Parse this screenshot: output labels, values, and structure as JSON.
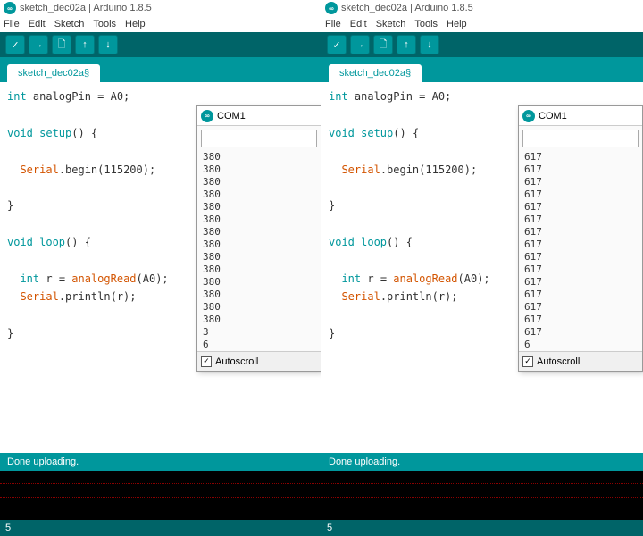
{
  "app": {
    "title_left": "sketch_dec02a | Arduino 1.8.5",
    "title_right": "sketch_dec02a | Arduino 1.8.5",
    "logo_text": "∞"
  },
  "menu": {
    "items": [
      "File",
      "Edit",
      "Sketch",
      "Tools",
      "Help"
    ]
  },
  "toolbar": {
    "verify": "✓",
    "upload": "→",
    "new": "🗋",
    "open": "↑",
    "save": "↓"
  },
  "tabs": {
    "name": "sketch_dec02a",
    "modified": "§"
  },
  "code": {
    "l1a": "int",
    "l1b": " analogPin = A0;",
    "l2a": "void",
    "l2b": " setup",
    "l2c": "() {",
    "l3a": "Serial",
    "l3b": ".begin",
    "l3c": "(115200);",
    "l4": "}",
    "l5a": "void",
    "l5b": " loop",
    "l5c": "() {",
    "l6a": "int",
    "l6b": " r = ",
    "l6c": "analogRead",
    "l6d": "(A0);",
    "l7a": "Serial",
    "l7b": ".println",
    "l7c": "(r);",
    "l8": "}"
  },
  "status": {
    "msg": "Done uploading."
  },
  "bottom": {
    "line": "5"
  },
  "serial": {
    "port": "COM1",
    "autoscroll": "Autoscroll",
    "check": "✓",
    "left_lines": [
      "380",
      "380",
      "380",
      "380",
      "380",
      "380",
      "380",
      "380",
      "380",
      "380",
      "380",
      "380",
      "380",
      "380",
      "3",
      "6"
    ],
    "right_lines": [
      "617",
      "617",
      "617",
      "617",
      "617",
      "617",
      "617",
      "617",
      "617",
      "617",
      "617",
      "617",
      "617",
      "617",
      "617",
      "6"
    ]
  }
}
